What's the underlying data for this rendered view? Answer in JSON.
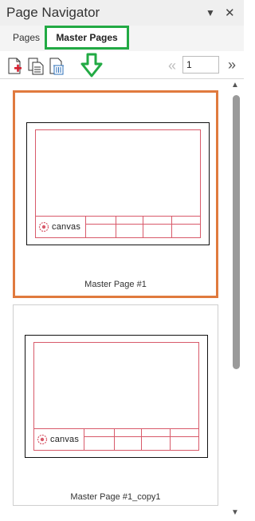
{
  "panel": {
    "title": "Page Navigator"
  },
  "tabs": [
    {
      "label": "Pages",
      "active": false
    },
    {
      "label": "Master Pages",
      "active": true
    }
  ],
  "toolbar": {
    "add_page_icon": "add-page-icon",
    "duplicate_page_icon": "duplicate-page-icon",
    "delete_page_icon": "delete-page-icon",
    "page_number_value": "1"
  },
  "thumbnails": [
    {
      "label": "Master Page #1",
      "selected": true,
      "logo": "canvas"
    },
    {
      "label": "Master Page #1_copy1",
      "selected": false,
      "logo": "canvas"
    }
  ],
  "colors": {
    "selection_border": "#e07a3e",
    "tab_highlight": "#22aa44",
    "title_block_lines": "#d85a6a"
  }
}
